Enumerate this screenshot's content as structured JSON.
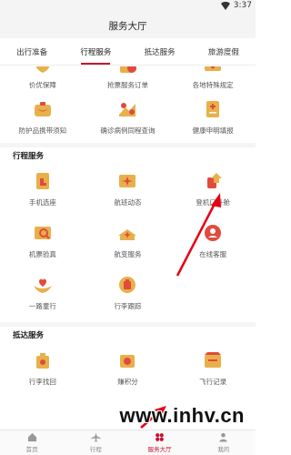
{
  "status_bar": {
    "time": "3:37"
  },
  "header": {
    "title": "服务大厅"
  },
  "tabs": [
    {
      "label": "出行准备"
    },
    {
      "label": "行程服务",
      "active": true
    },
    {
      "label": "抵达服务"
    },
    {
      "label": "旅游度假"
    }
  ],
  "top_items": [
    {
      "label": "价优保障",
      "icon": "price-guarantee-icon"
    },
    {
      "label": "抢票服务订单",
      "icon": "ticket-grab-icon"
    },
    {
      "label": "各地特殊规定",
      "icon": "regional-rules-icon"
    },
    {
      "label": "防护品携带须知",
      "icon": "protective-items-icon"
    },
    {
      "label": "确诊病例同程查询",
      "icon": "case-query-icon"
    },
    {
      "label": "健康申明填报",
      "icon": "health-declaration-icon"
    }
  ],
  "sections": [
    {
      "title": "行程服务",
      "items": [
        {
          "label": "手机选座",
          "icon": "seat-selection-icon"
        },
        {
          "label": "航班动态",
          "icon": "flight-status-icon"
        },
        {
          "label": "登机口升舱",
          "icon": "gate-upgrade-icon"
        },
        {
          "label": "机票验真",
          "icon": "ticket-verify-icon"
        },
        {
          "label": "航变服务",
          "icon": "flight-change-icon"
        },
        {
          "label": "在线客服",
          "icon": "online-support-icon"
        },
        {
          "label": "一路童行",
          "icon": "child-travel-icon"
        },
        {
          "label": "行李跟踪",
          "icon": "baggage-tracking-icon"
        }
      ]
    },
    {
      "title": "抵达服务",
      "items": [
        {
          "label": "行李找回",
          "icon": "baggage-recovery-icon"
        },
        {
          "label": "赚积分",
          "icon": "earn-points-icon"
        },
        {
          "label": "飞行记录",
          "icon": "flight-record-icon"
        }
      ]
    }
  ],
  "bottom_nav": [
    {
      "label": "首页",
      "icon": "home-icon"
    },
    {
      "label": "行程",
      "icon": "plane-icon"
    },
    {
      "label": "服务大厅",
      "icon": "service-hall-icon",
      "active": true
    },
    {
      "label": "我的",
      "icon": "profile-icon"
    }
  ],
  "watermark": "www.inhv.cn",
  "colors": {
    "accent": "#c8102e",
    "icon_gold": "#e8b04a",
    "icon_red": "#e04b3c"
  }
}
